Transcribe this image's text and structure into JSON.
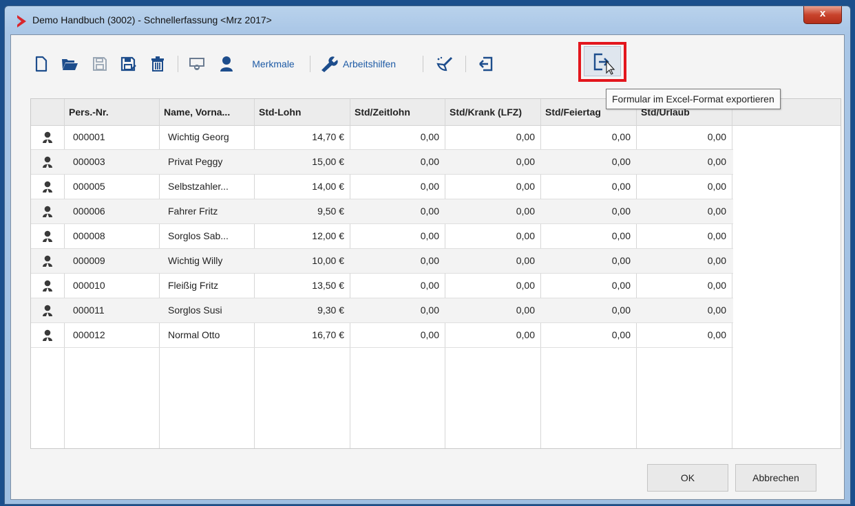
{
  "window": {
    "title": "Demo Handbuch (3002) - Schnellerfassung <Mrz 2017>",
    "close_label": "x"
  },
  "toolbar": {
    "merkmale_label": "Merkmale",
    "arbeitshilfen_label": "Arbeitshilfen",
    "tooltip": "Formular im Excel-Format exportieren"
  },
  "table": {
    "columns": [
      "",
      "Pers.-Nr.",
      "Name, Vorna...",
      "Std-Lohn",
      "Std/Zeitlohn",
      "Std/Krank (LFZ)",
      "Std/Feiertag",
      "Std/Urlaub"
    ],
    "rows": [
      {
        "nr": "000001",
        "name": "Wichtig Georg",
        "lohn": "14,70 €",
        "zeit": "0,00",
        "krank": "0,00",
        "feiertag": "0,00",
        "urlaub": "0,00"
      },
      {
        "nr": "000003",
        "name": "Privat Peggy",
        "lohn": "15,00 €",
        "zeit": "0,00",
        "krank": "0,00",
        "feiertag": "0,00",
        "urlaub": "0,00"
      },
      {
        "nr": "000005",
        "name": "Selbstzahler...",
        "lohn": "14,00 €",
        "zeit": "0,00",
        "krank": "0,00",
        "feiertag": "0,00",
        "urlaub": "0,00"
      },
      {
        "nr": "000006",
        "name": "Fahrer Fritz",
        "lohn": "9,50 €",
        "zeit": "0,00",
        "krank": "0,00",
        "feiertag": "0,00",
        "urlaub": "0,00"
      },
      {
        "nr": "000008",
        "name": "Sorglos Sab...",
        "lohn": "12,00 €",
        "zeit": "0,00",
        "krank": "0,00",
        "feiertag": "0,00",
        "urlaub": "0,00"
      },
      {
        "nr": "000009",
        "name": "Wichtig Willy",
        "lohn": "10,00 €",
        "zeit": "0,00",
        "krank": "0,00",
        "feiertag": "0,00",
        "urlaub": "0,00"
      },
      {
        "nr": "000010",
        "name": "Fleißig Fritz",
        "lohn": "13,50 €",
        "zeit": "0,00",
        "krank": "0,00",
        "feiertag": "0,00",
        "urlaub": "0,00"
      },
      {
        "nr": "000011",
        "name": "Sorglos Susi",
        "lohn": "9,30 €",
        "zeit": "0,00",
        "krank": "0,00",
        "feiertag": "0,00",
        "urlaub": "0,00"
      },
      {
        "nr": "000012",
        "name": "Normal Otto",
        "lohn": "16,70 €",
        "zeit": "0,00",
        "krank": "0,00",
        "feiertag": "0,00",
        "urlaub": "0,00"
      }
    ]
  },
  "buttons": {
    "ok": "OK",
    "cancel": "Abbrechen"
  },
  "colors": {
    "accent": "#1d4d8c",
    "highlight": "#e3161d"
  }
}
